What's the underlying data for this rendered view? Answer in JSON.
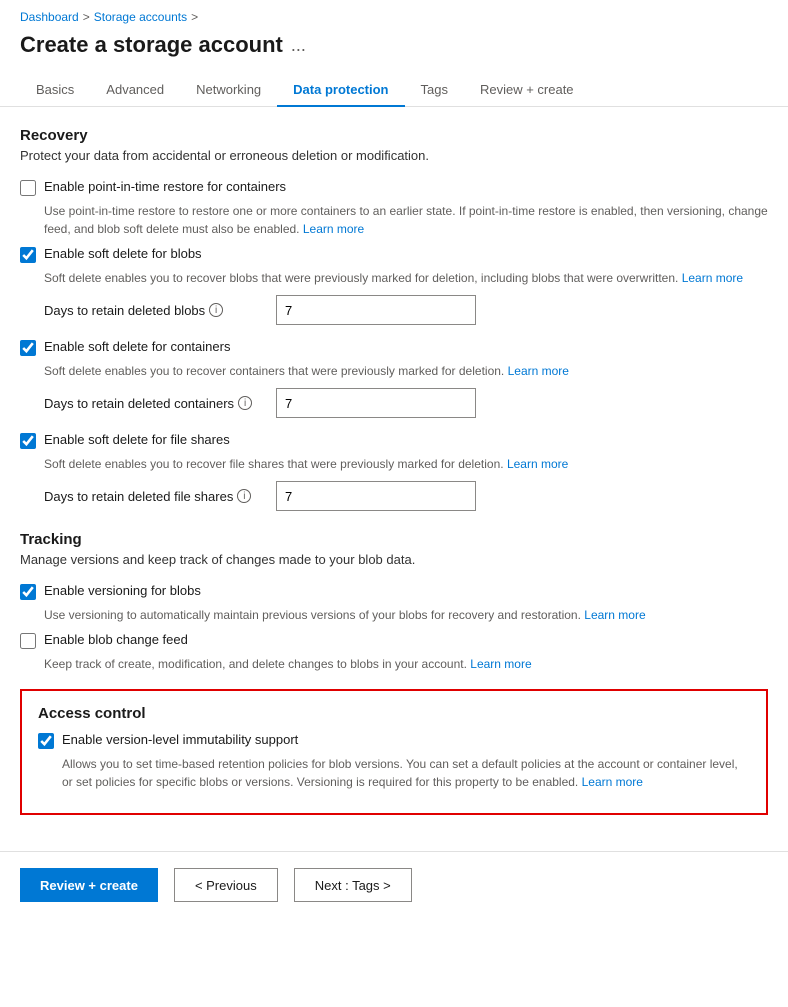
{
  "breadcrumb": {
    "dashboard": "Dashboard",
    "storage_accounts": "Storage accounts",
    "separator1": ">",
    "separator2": ">"
  },
  "page": {
    "title": "Create a storage account",
    "ellipsis": "..."
  },
  "tabs": [
    {
      "id": "basics",
      "label": "Basics",
      "active": false
    },
    {
      "id": "advanced",
      "label": "Advanced",
      "active": false
    },
    {
      "id": "networking",
      "label": "Networking",
      "active": false
    },
    {
      "id": "data-protection",
      "label": "Data protection",
      "active": true
    },
    {
      "id": "tags",
      "label": "Tags",
      "active": false
    },
    {
      "id": "review-create",
      "label": "Review + create",
      "active": false
    }
  ],
  "recovery": {
    "title": "Recovery",
    "description": "Protect your data from accidental or erroneous deletion or modification.",
    "items": [
      {
        "id": "point-in-time",
        "label": "Enable point-in-time restore for containers",
        "checked": false,
        "desc": "Use point-in-time restore to restore one or more containers to an earlier state. If point-in-time restore is enabled, then versioning, change feed, and blob soft delete must also be enabled.",
        "learn_more": "Learn more",
        "has_field": false
      },
      {
        "id": "soft-delete-blobs",
        "label": "Enable soft delete for blobs",
        "checked": true,
        "desc": "Soft delete enables you to recover blobs that were previously marked for deletion, including blobs that were overwritten.",
        "learn_more": "Learn more",
        "has_field": true,
        "field_label": "Days to retain deleted blobs",
        "field_value": "7"
      },
      {
        "id": "soft-delete-containers",
        "label": "Enable soft delete for containers",
        "checked": true,
        "desc": "Soft delete enables you to recover containers that were previously marked for deletion.",
        "learn_more": "Learn more",
        "has_field": true,
        "field_label": "Days to retain deleted containers",
        "field_value": "7"
      },
      {
        "id": "soft-delete-files",
        "label": "Enable soft delete for file shares",
        "checked": true,
        "desc": "Soft delete enables you to recover file shares that were previously marked for deletion.",
        "learn_more": "Learn more",
        "has_field": true,
        "field_label": "Days to retain deleted file shares",
        "field_value": "7"
      }
    ]
  },
  "tracking": {
    "title": "Tracking",
    "description": "Manage versions and keep track of changes made to your blob data.",
    "items": [
      {
        "id": "versioning",
        "label": "Enable versioning for blobs",
        "checked": true,
        "desc": "Use versioning to automatically maintain previous versions of your blobs for recovery and restoration.",
        "learn_more": "Learn more",
        "has_field": false
      },
      {
        "id": "change-feed",
        "label": "Enable blob change feed",
        "checked": false,
        "desc": "Keep track of create, modification, and delete changes to blobs in your account.",
        "learn_more": "Learn more",
        "has_field": false
      }
    ]
  },
  "access_control": {
    "title": "Access control",
    "item": {
      "id": "immutability",
      "label": "Enable version-level immutability support",
      "checked": true,
      "desc": "Allows you to set time-based retention policies for blob versions. You can set a default policies at the account or container level, or set policies for specific blobs or versions. Versioning is required for this property to be enabled.",
      "learn_more": "Learn more"
    }
  },
  "footer": {
    "review_create": "Review + create",
    "previous": "< Previous",
    "next": "Next : Tags >"
  }
}
